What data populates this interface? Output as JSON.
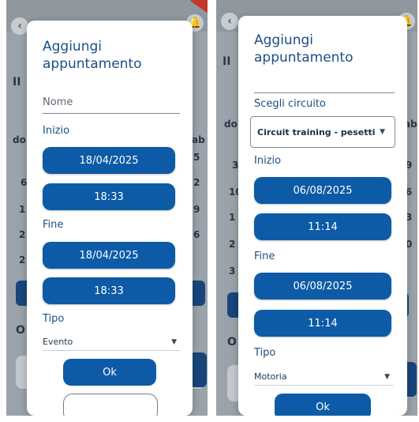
{
  "left": {
    "dialog_title_line1": "Aggiungi",
    "dialog_title_line2": "appuntamento",
    "name_placeholder": "Nome",
    "start_label": "Inizio",
    "start_date": "18/04/2025",
    "start_time": "18:33",
    "end_label": "Fine",
    "end_date": "18/04/2025",
    "end_time": "18:33",
    "type_label": "Tipo",
    "type_value": "Evento",
    "ok_label": "Ok",
    "bg_fragments": [
      "do",
      "ab",
      "6",
      "2",
      "1",
      "9",
      "2",
      "6",
      "2",
      "O",
      "5",
      "II"
    ]
  },
  "right": {
    "dialog_title_line1": "Aggiungi",
    "dialog_title_line2": "appuntamento",
    "circuit_label": "Scegli circuito",
    "circuit_value": "Circuit training - pesetti",
    "start_label": "Inizio",
    "start_date": "06/08/2025",
    "start_time": "11:14",
    "end_label": "Fine",
    "end_date": "06/08/2025",
    "end_time": "11:14",
    "type_label": "Tipo",
    "type_value": "Motoria",
    "ok_label_partial": "Ok",
    "bg_fragments": [
      "do",
      "ab",
      "3",
      "9",
      "10",
      "6",
      "1",
      "3",
      "2",
      "0",
      "3",
      "2",
      "O",
      "II"
    ]
  },
  "colors": {
    "primary": "#0d5ba6",
    "title": "#1c4f84",
    "overlay": "#9aa3ab"
  },
  "icons": {
    "back": "chevron-left-icon",
    "bell": "bell-icon",
    "caret": "caret-down-icon"
  }
}
